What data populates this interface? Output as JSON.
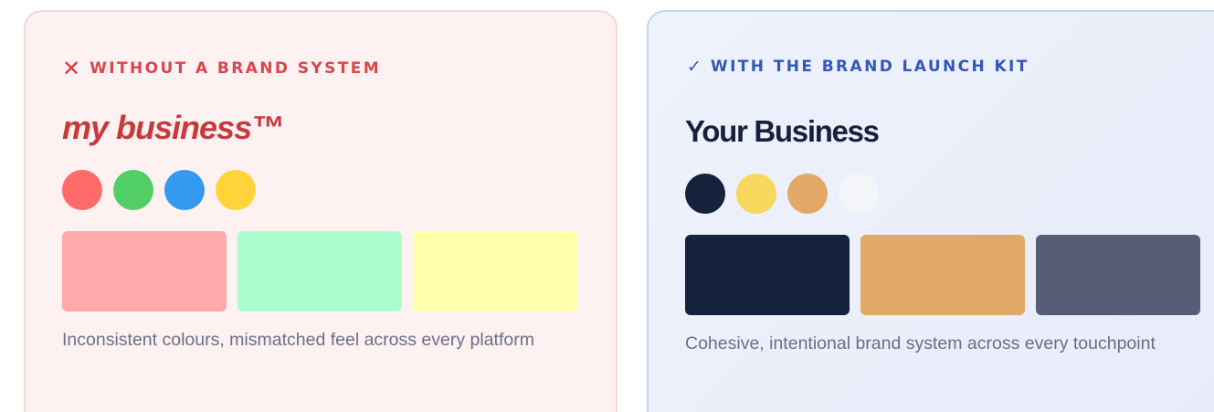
{
  "comparison": {
    "bad": {
      "icon": "cross-mark-icon",
      "icon_glyph": "✕",
      "heading": "WITHOUT A BRAND SYSTEM",
      "brand_name": "my business™",
      "dot_colors": [
        "#ff6b6b",
        "#51cf66",
        "#339af0",
        "#ffd43b"
      ],
      "swatch_colors": [
        "#ffaaaa",
        "#aaffcc",
        "#ffffaa"
      ],
      "caption": "Inconsistent colours, mismatched feel across every platform",
      "accent_color": "#d9474b"
    },
    "good": {
      "icon": "check-mark-icon",
      "icon_glyph": "✓",
      "heading": "WITH THE BRAND LAUNCH KIT",
      "brand_name": "Your Business",
      "dot_colors": [
        "#16213b",
        "#f9d65c",
        "#e2a966",
        "#f4f5f9"
      ],
      "swatch_colors": [
        "#16213b",
        "#e2a966",
        "#555d77"
      ],
      "caption": "Cohesive, intentional brand system across every touchpoint",
      "accent_color": "#3557b9"
    }
  }
}
